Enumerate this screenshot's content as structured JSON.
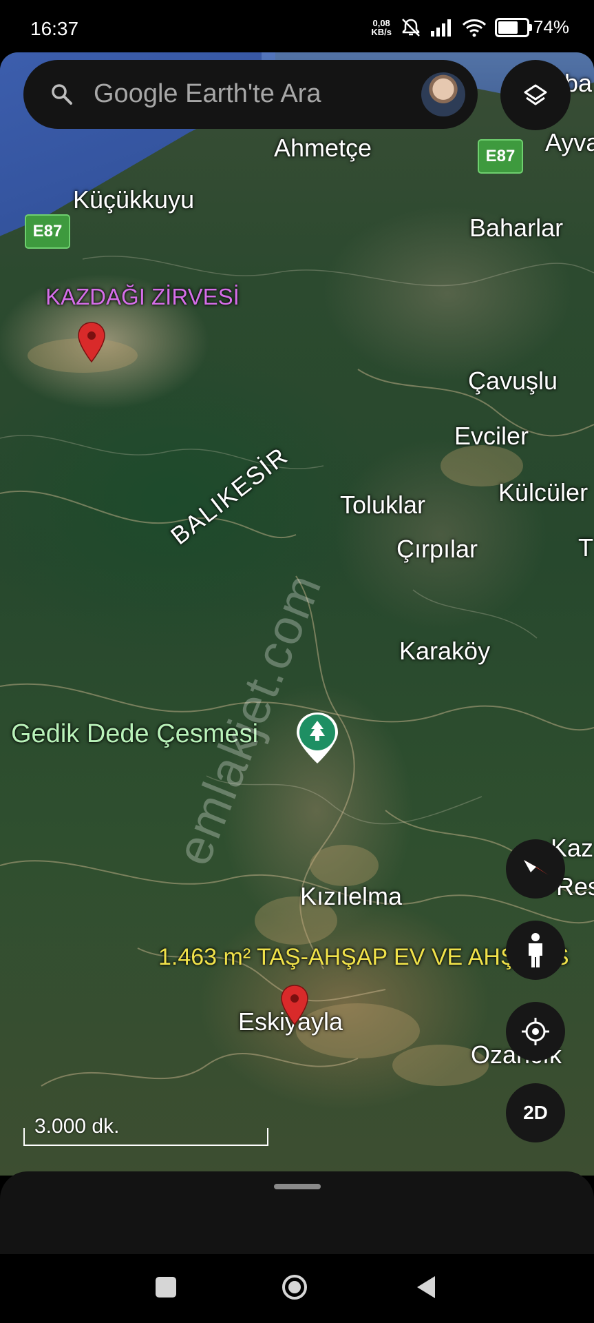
{
  "status_bar": {
    "time": "16:37",
    "net_speed_value": "0,08",
    "net_speed_unit": "KB/s",
    "battery": "74%",
    "battery_level": 0.74,
    "icons": [
      "mute-icon",
      "signal-icon",
      "wifi-icon",
      "battery-icon"
    ]
  },
  "search": {
    "placeholder": "Google Earth'te Ara",
    "icon": "search-icon"
  },
  "map": {
    "places": {
      "ahmetce": "Ahmetçe",
      "kucukkuyu": "Küçükkuyu",
      "baharlar": "Baharlar",
      "ayva": "Ayva",
      "ba": "ba",
      "cavuslu": "Çavuşlu",
      "evciler": "Evciler",
      "kulculer": "Külcüler",
      "toluklar": "Toluklar",
      "cirpilar": "Çırpılar",
      "t": "T",
      "karakoy": "Karaköy",
      "kizilelma": "Kızılelma",
      "eskiyayla": "Eskiyayla",
      "ozancik": "Ozancık",
      "kaz": "Kaz",
      "res": "Res"
    },
    "summit": "KAZDAĞI ZİRVESİ",
    "province": "BALIKESİR",
    "park": "Gedik Dede Çesmesi",
    "listing": "1.463 m² TAŞ-AHŞAP EV VE AHŞAP S",
    "road_badges": [
      "E87",
      "E87"
    ],
    "watermark": "emlakjet.com",
    "scale_label": "3.000 dk."
  },
  "controls": {
    "compass": "compass-icon",
    "street_view": "pegman-icon",
    "location": "my-location-icon",
    "view_2d": "2D",
    "layers": "layers-icon"
  },
  "colors": {
    "summit": "#d56ee8",
    "park_label": "#b9f2b9",
    "listing": "#f0e24a",
    "pin": "#d92a2a",
    "park_pin": "#1e8f63",
    "road_badge": "#3e9a3e"
  }
}
